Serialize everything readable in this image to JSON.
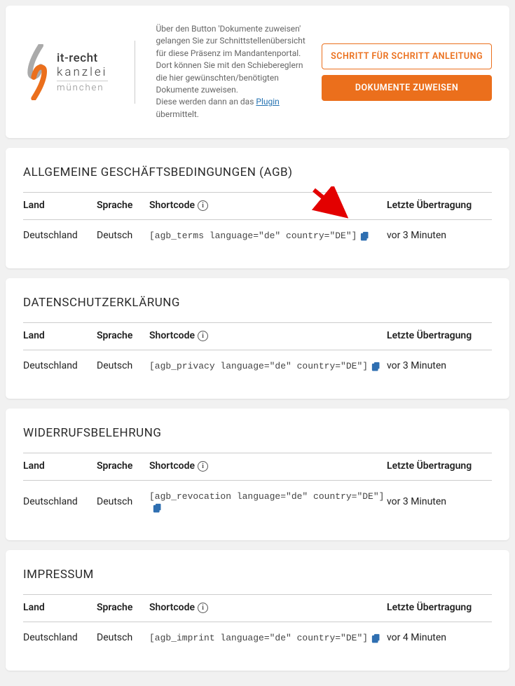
{
  "header": {
    "logo_line1": "it-recht",
    "logo_line2": "kanzlei",
    "logo_line3": "münchen",
    "desc_l1": "Über den Button 'Dokumente zuweisen' gelangen Sie zur Schnittstellenübersicht für diese Präsenz im Mandantenportal.",
    "desc_l2": "Dort können Sie mit den Schiebereglern die hier gewünschten/benötigten Dokumente zuweisen.",
    "desc_l3a": "Diese werden dann an das ",
    "desc_l3_link": "Plugin",
    "desc_l3b": " übermittelt.",
    "btn_outline": "SCHRITT FÜR SCHRITT ANLEITUNG",
    "btn_solid": "DOKUMENTE ZUWEISEN"
  },
  "columns": {
    "land": "Land",
    "sprache": "Sprache",
    "shortcode": "Shortcode",
    "letzte": "Letzte Übertragung"
  },
  "sections": [
    {
      "title": "ALLGEMEINE GESCHÄFTSBEDINGUNGEN (AGB)",
      "rows": [
        {
          "land": "Deutschland",
          "sprache": "Deutsch",
          "shortcode": "[agb_terms language=\"de\" country=\"DE\"]",
          "date": "vor 3 Minuten",
          "arrow": true
        }
      ]
    },
    {
      "title": "DATENSCHUTZERKLÄRUNG",
      "rows": [
        {
          "land": "Deutschland",
          "sprache": "Deutsch",
          "shortcode": "[agb_privacy language=\"de\" country=\"DE\"]",
          "date": "vor 3 Minuten"
        }
      ]
    },
    {
      "title": "WIDERRUFSBELEHRUNG",
      "rows": [
        {
          "land": "Deutschland",
          "sprache": "Deutsch",
          "shortcode": "[agb_revocation language=\"de\" country=\"DE\"]",
          "date": "vor 3 Minuten"
        }
      ]
    },
    {
      "title": "IMPRESSUM",
      "rows": [
        {
          "land": "Deutschland",
          "sprache": "Deutsch",
          "shortcode": "[agb_imprint language=\"de\" country=\"DE\"]",
          "date": "vor 4 Minuten"
        }
      ]
    }
  ]
}
